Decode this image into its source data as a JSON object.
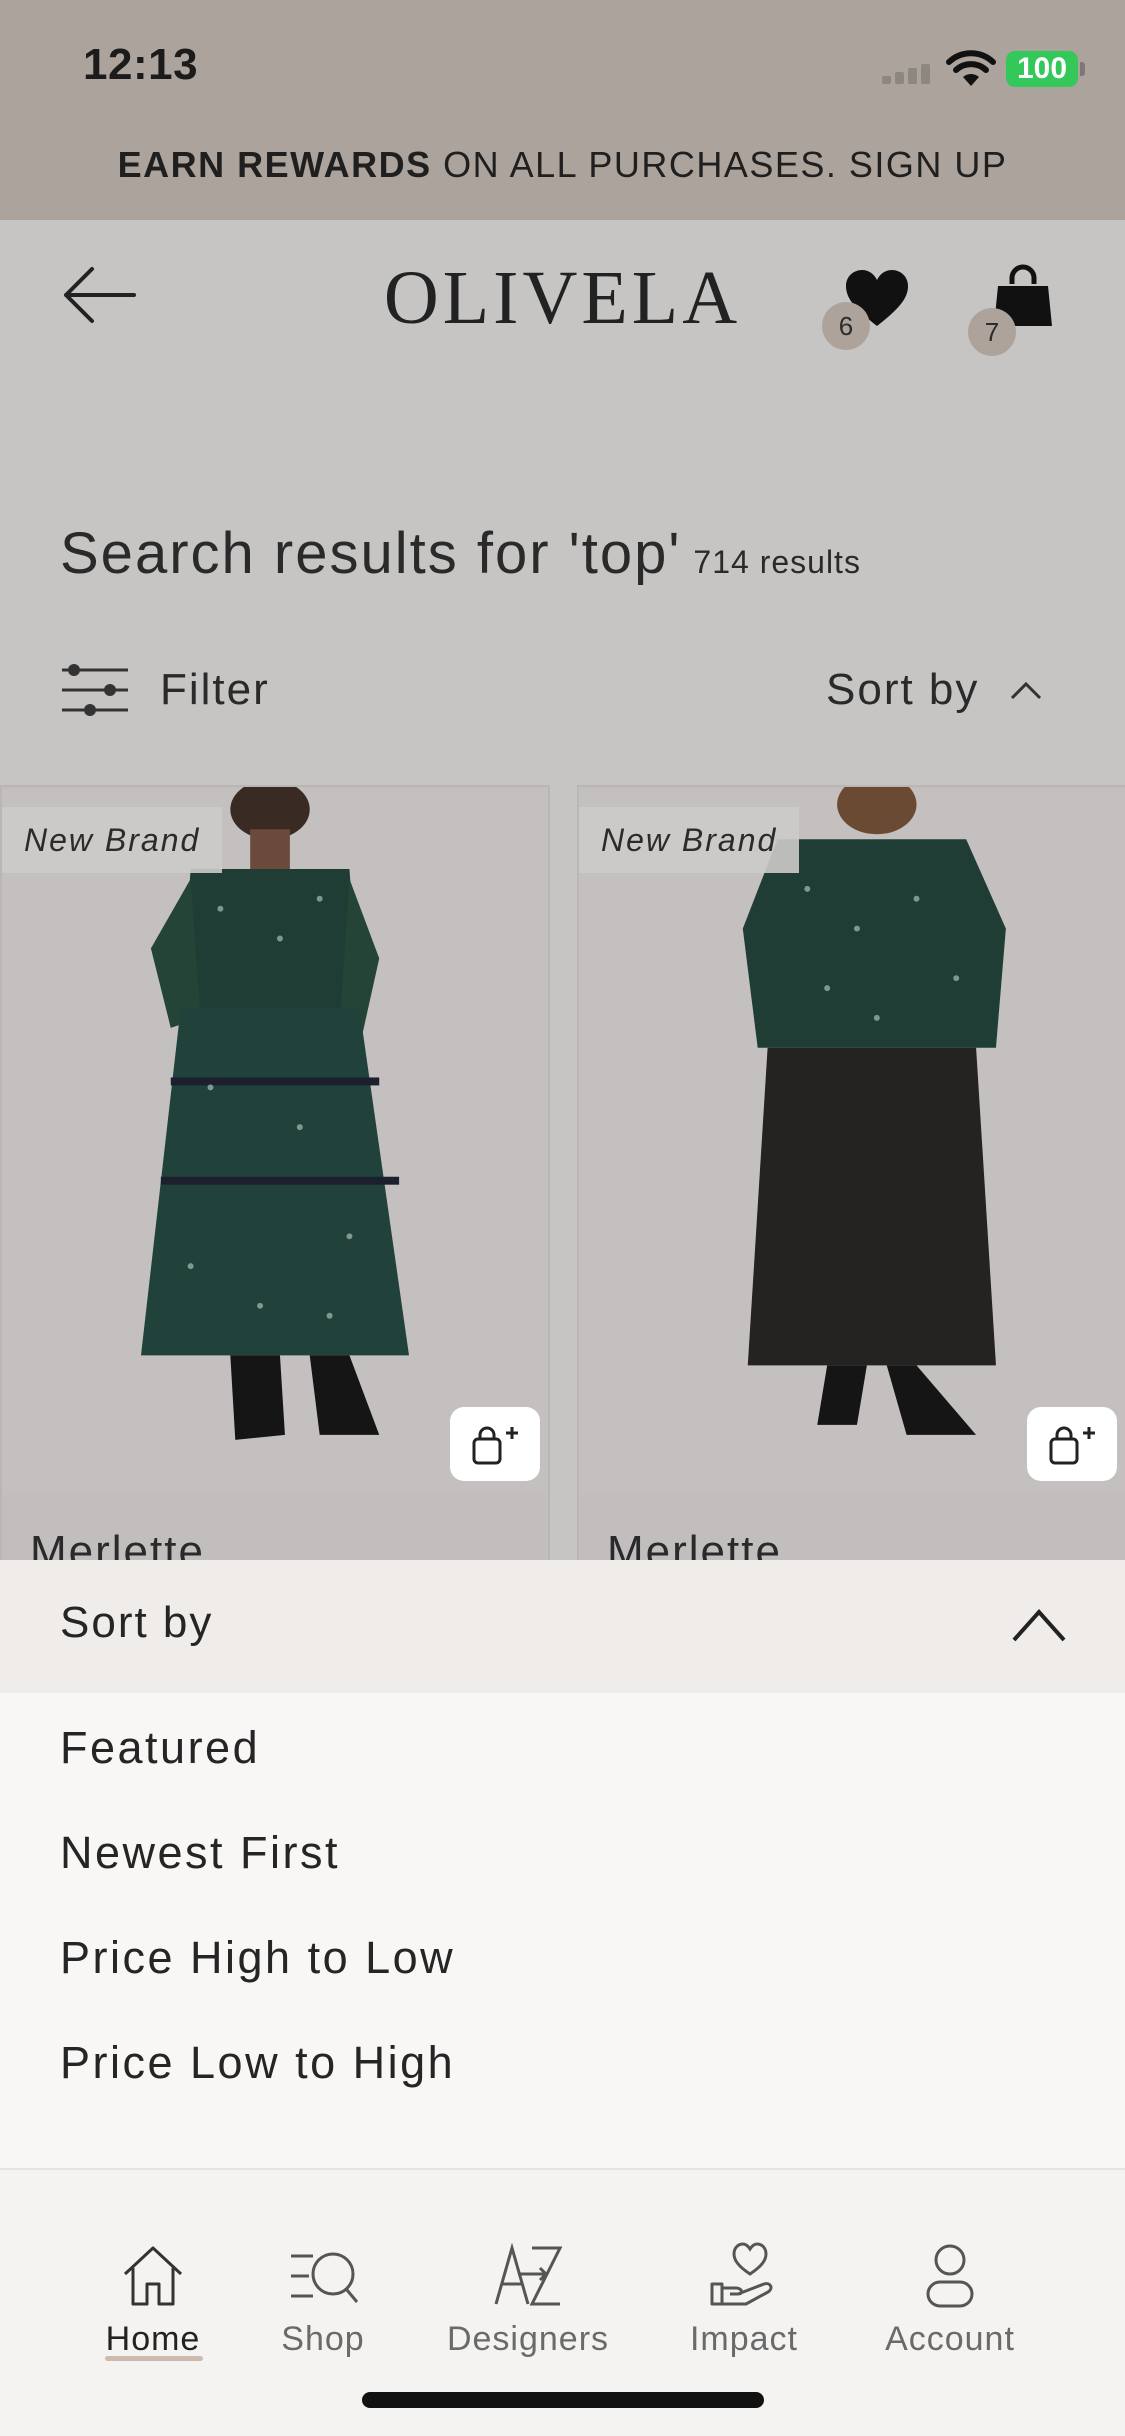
{
  "status_bar": {
    "time": "12:13",
    "battery": "100"
  },
  "promo": {
    "bold": "EARN REWARDS",
    "rest": " ON ALL PURCHASES. SIGN UP"
  },
  "header": {
    "logo": "OLIVELA",
    "wishlist_count": "6",
    "bag_count": "7"
  },
  "search": {
    "title": "Search results for 'top'",
    "results": "714 results"
  },
  "toolbar": {
    "filter_label": "Filter",
    "sort_label": "Sort by"
  },
  "products": [
    {
      "tag": "New Brand",
      "name": "Merlette"
    },
    {
      "tag": "New Brand",
      "name": "Merlette"
    }
  ],
  "sort_sheet": {
    "title": "Sort by",
    "options": [
      "Featured",
      "Newest First",
      "Price High to Low",
      "Price Low to High"
    ]
  },
  "tabbar": {
    "items": [
      {
        "label": "Home",
        "icon": "home-icon",
        "active": true
      },
      {
        "label": "Shop",
        "icon": "shop-search-icon"
      },
      {
        "label": "Designers",
        "icon": "a-to-z-icon"
      },
      {
        "label": "Impact",
        "icon": "heart-hand-icon"
      },
      {
        "label": "Account",
        "icon": "person-icon"
      }
    ]
  }
}
